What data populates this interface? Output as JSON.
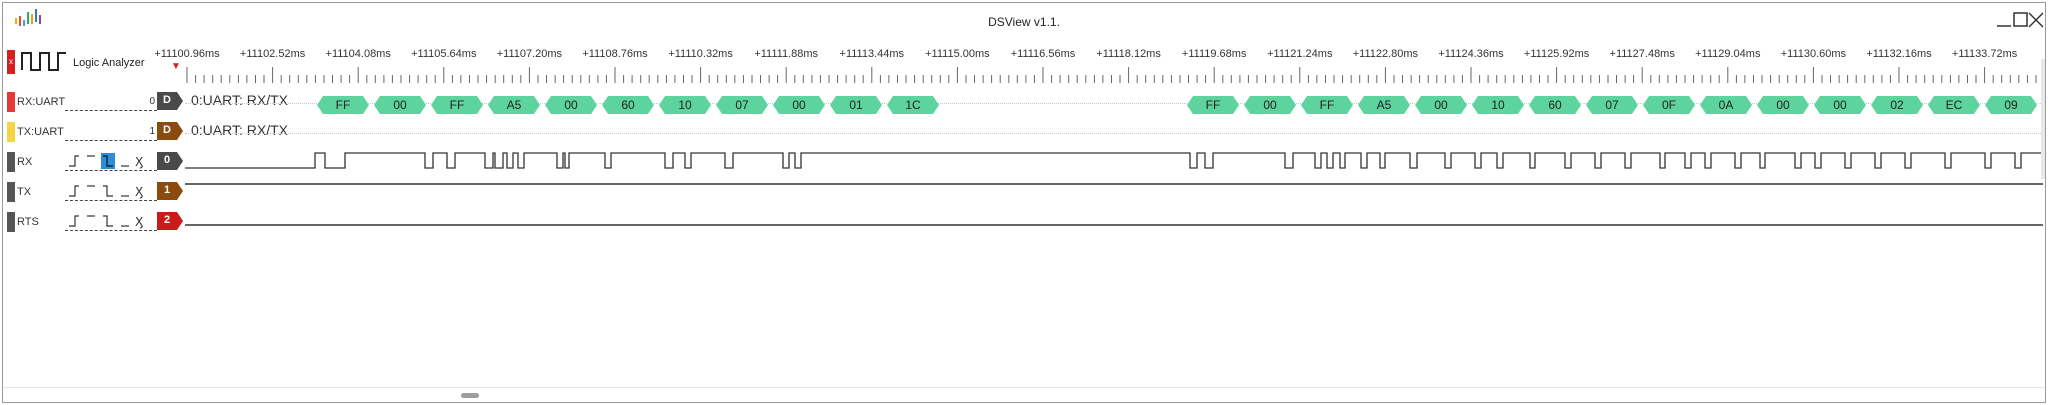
{
  "window": {
    "title": "DSView v1.1."
  },
  "toolbar": {
    "mode_label": "Logic Analyzer",
    "accent": "#cc2222"
  },
  "ruler": {
    "labels": [
      "+11100.96ms",
      "+11102.52ms",
      "+11104.08ms",
      "+11105.64ms",
      "+11107.20ms",
      "+11108.76ms",
      "+11110.32ms",
      "+11111.88ms",
      "+11113.44ms",
      "+11115.00ms",
      "+11116.56ms",
      "+11118.12ms",
      "+11119.68ms",
      "+11121.24ms",
      "+11122.80ms",
      "+11124.36ms",
      "+11125.92ms",
      "+11127.48ms",
      "+11129.04ms",
      "+11130.60ms",
      "+11132.16ms",
      "+11133.72ms"
    ]
  },
  "channels": [
    {
      "name": "RX:UART",
      "num": "0",
      "handle": "D",
      "color": "#e53935",
      "handle_color": "#4a4a4a",
      "decoder": "0:UART: RX/TX"
    },
    {
      "name": "TX:UART",
      "num": "1",
      "handle": "D",
      "color": "#f5d442",
      "handle_color": "#8b4a0e",
      "decoder": "0:UART: RX/TX"
    },
    {
      "name": "RX",
      "handle": "0",
      "color": "#555555",
      "handle_color": "#4a4a4a"
    },
    {
      "name": "TX",
      "handle": "1",
      "color": "#555555",
      "handle_color": "#8b4a0e"
    },
    {
      "name": "RTS",
      "handle": "2",
      "color": "#555555",
      "handle_color": "#cc1a1a"
    }
  ],
  "rx_bytes": [
    "FF",
    "00",
    "FF",
    "A5",
    "00",
    "60",
    "10",
    "07",
    "00",
    "01",
    "1C",
    "FF",
    "00",
    "FF",
    "A5",
    "00",
    "10",
    "60",
    "07",
    "0F",
    "0A",
    "00",
    "00",
    "02",
    "EC",
    "09"
  ],
  "packet_color": "#5dd39e",
  "icons": {
    "app": "dsview-logo-icon",
    "minimize": "minimize-icon",
    "maximize": "maximize-icon",
    "close": "close-icon",
    "mode": "logic-wave-icon",
    "dropdown": "chevron-down-icon"
  }
}
